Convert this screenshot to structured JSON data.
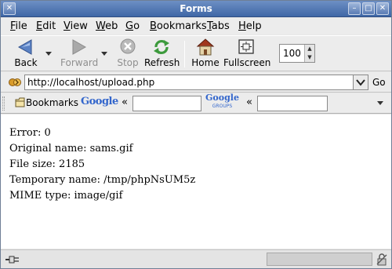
{
  "window": {
    "title": "Forms"
  },
  "menubar": {
    "items": [
      {
        "pre": "",
        "ul": "F",
        "post": "ile"
      },
      {
        "pre": "",
        "ul": "E",
        "post": "dit"
      },
      {
        "pre": "",
        "ul": "V",
        "post": "iew"
      },
      {
        "pre": "",
        "ul": "W",
        "post": "eb"
      },
      {
        "pre": "",
        "ul": "G",
        "post": "o"
      },
      {
        "pre": "",
        "ul": "B",
        "post": "ookmarks"
      },
      {
        "pre": "",
        "ul": "T",
        "post": "abs"
      },
      {
        "pre": "",
        "ul": "H",
        "post": "elp"
      }
    ]
  },
  "toolbar": {
    "back_label": "Back",
    "forward_label": "Forward",
    "stop_label": "Stop",
    "refresh_label": "Refresh",
    "home_label": "Home",
    "fullscreen_label": "Fullscreen",
    "zoom_value": "100"
  },
  "location": {
    "url": "http://localhost/upload.php",
    "go_label": "Go"
  },
  "personal": {
    "bookmarks_label": "Bookmarks",
    "google_label": "Google",
    "groups_top": "Google",
    "groups_bottom": "GROUPS",
    "chevron": "«"
  },
  "content": {
    "lines": [
      "Error: 0",
      "Original name: sams.gif",
      "File size: 2185",
      "Temporary name: /tmp/phpNsUM5z",
      "MIME type: image/gif"
    ]
  },
  "colors": {
    "titlebar": "#4f74b0",
    "google_blue": "#3366cc",
    "google_red": "#d62d20",
    "google_yellow": "#eeb211",
    "google_green": "#3c9a3c"
  }
}
